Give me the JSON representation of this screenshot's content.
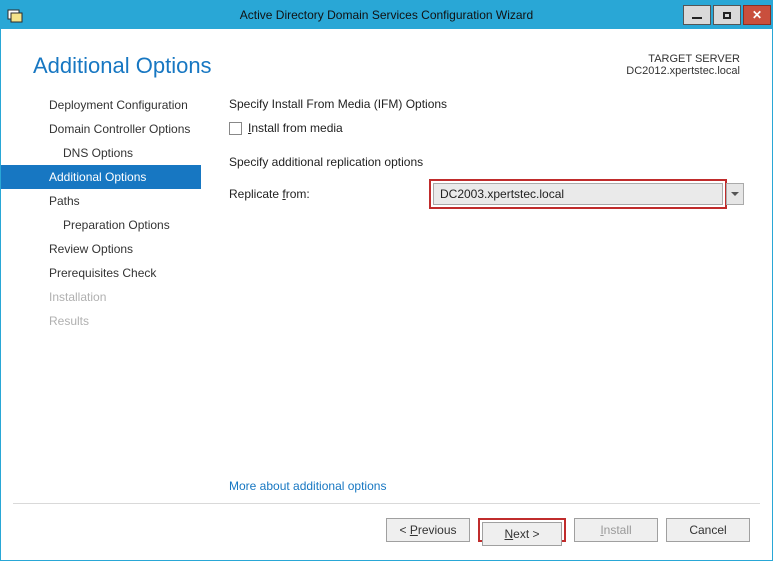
{
  "window": {
    "title": "Active Directory Domain Services Configuration Wizard"
  },
  "header": {
    "page_title": "Additional Options",
    "target_label": "TARGET SERVER",
    "target_value": "DC2012.xpertstec.local"
  },
  "nav": {
    "items": [
      {
        "label": "Deployment Configuration",
        "level": "top",
        "state": "normal"
      },
      {
        "label": "Domain Controller Options",
        "level": "top",
        "state": "normal"
      },
      {
        "label": "DNS Options",
        "level": "sub",
        "state": "normal"
      },
      {
        "label": "Additional Options",
        "level": "top",
        "state": "selected"
      },
      {
        "label": "Paths",
        "level": "top",
        "state": "normal"
      },
      {
        "label": "Preparation Options",
        "level": "sub",
        "state": "normal"
      },
      {
        "label": "Review Options",
        "level": "top",
        "state": "normal"
      },
      {
        "label": "Prerequisites Check",
        "level": "top",
        "state": "normal"
      },
      {
        "label": "Installation",
        "level": "top",
        "state": "disabled"
      },
      {
        "label": "Results",
        "level": "top",
        "state": "disabled"
      }
    ]
  },
  "content": {
    "ifm_heading": "Specify Install From Media (IFM) Options",
    "install_media_label": "Install from media",
    "install_media_checked": false,
    "replication_heading": "Specify additional replication options",
    "replicate_label": "Replicate from:",
    "replicate_value": "DC2003.xpertstec.local",
    "more_link": "More about additional options"
  },
  "footer": {
    "previous": "< Previous",
    "next": "Next >",
    "install": "Install",
    "cancel": "Cancel"
  }
}
